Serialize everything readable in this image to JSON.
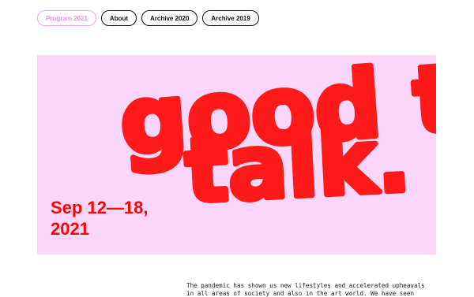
{
  "nav": {
    "items": [
      {
        "label": "Program 2021",
        "active": true
      },
      {
        "label": "About",
        "active": false
      },
      {
        "label": "Archive 2020",
        "active": false
      },
      {
        "label": "Archive 2019",
        "active": false
      }
    ]
  },
  "hero": {
    "line1": "good to",
    "line2": "talk.",
    "dates_line1": "Sep 12—18,",
    "dates_line2": "2021",
    "background": "#fad6fb",
    "accent": "#ff1a1a"
  },
  "intro": {
    "line1": "The pandemic has shown us new lifestyles and accelerated upheavals",
    "line2": "in all areas of society and also in the art world. We have seen"
  }
}
